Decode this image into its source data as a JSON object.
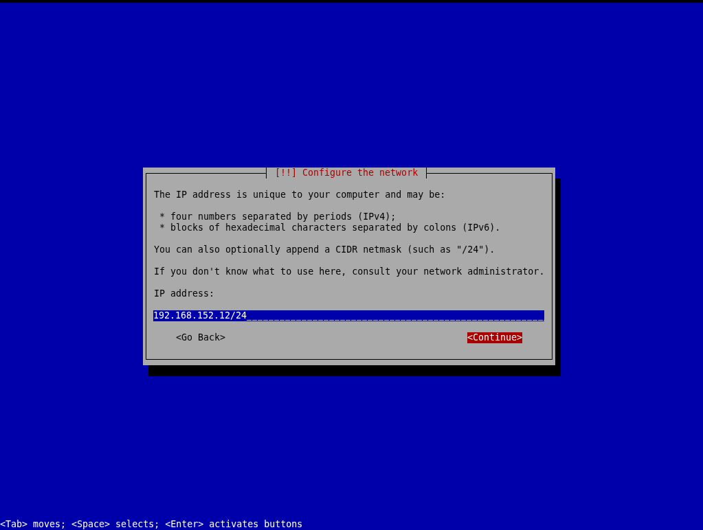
{
  "dialog": {
    "title": "[!!] Configure the network",
    "intro": "The IP address is unique to your computer and may be:",
    "bullets": [
      "* four numbers separated by periods (IPv4);",
      "* blocks of hexadecimal characters separated by colons (IPv6)."
    ],
    "notes": [
      "You can also optionally append a CIDR netmask (such as \"/24\").",
      "If you don't know what to use here, consult your network administrator."
    ],
    "field": {
      "label": "IP address:",
      "value": "192.168.152.12/24"
    },
    "buttons": [
      {
        "label": "<Go Back>",
        "selected": false
      },
      {
        "label": "<Continue>",
        "selected": true
      }
    ]
  },
  "status_bar": "<Tab> moves; <Space> selects; <Enter> activates buttons"
}
